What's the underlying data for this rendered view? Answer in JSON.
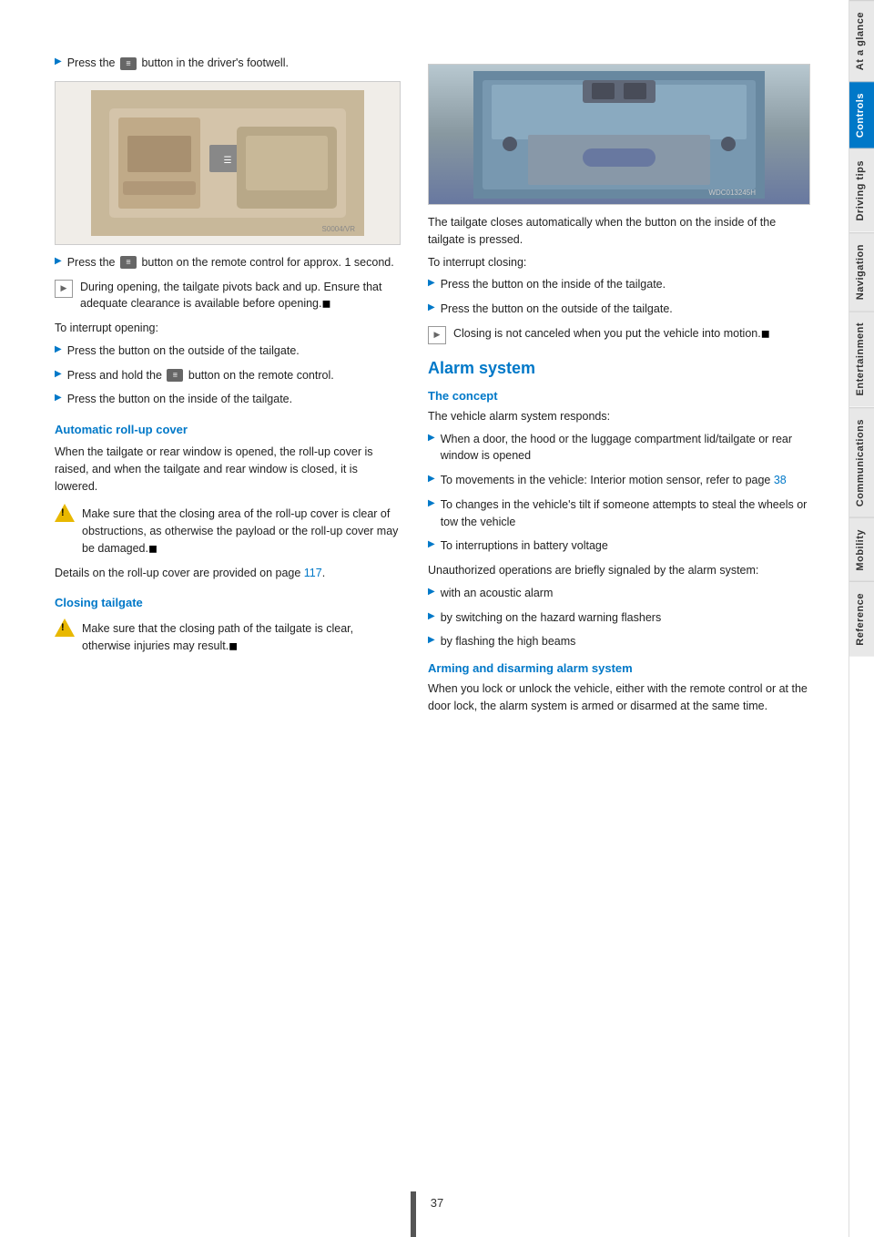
{
  "page": {
    "number": "37"
  },
  "sidebar": {
    "tabs": [
      {
        "id": "at-a-glance",
        "label": "At a glance",
        "active": false
      },
      {
        "id": "controls",
        "label": "Controls",
        "active": true
      },
      {
        "id": "driving-tips",
        "label": "Driving tips",
        "active": false
      },
      {
        "id": "navigation",
        "label": "Navigation",
        "active": false
      },
      {
        "id": "entertainment",
        "label": "Entertainment",
        "active": false
      },
      {
        "id": "communications",
        "label": "Communications",
        "active": false
      },
      {
        "id": "mobility",
        "label": "Mobility",
        "active": false
      },
      {
        "id": "reference",
        "label": "Reference",
        "active": false
      }
    ]
  },
  "left_column": {
    "intro_bullet": "Press the [icon] button in the driver's footwell.",
    "bullet2": "Press the [icon] button on the remote control for approx. 1 second.",
    "notice1": "During opening, the tailgate pivots back and up. Ensure that adequate clearance is available before opening.",
    "to_interrupt_opening": "To interrupt opening:",
    "interrupt_bullets": [
      "Press the button on the outside of the tailgate.",
      "Press and hold the [icon] button on the remote control.",
      "Press the button on the inside of the tailgate."
    ],
    "automatic_rollup_heading": "Automatic roll-up cover",
    "automatic_rollup_text": "When the tailgate or rear window is opened, the roll-up cover is raised, and when the tailgate and rear window is closed, it is lowered.",
    "warning1": "Make sure that the closing area of the roll-up cover is clear of obstructions, as otherwise the payload or the roll-up cover may be damaged.",
    "details_text": "Details on the roll-up cover are provided on page 117.",
    "closing_tailgate_heading": "Closing tailgate",
    "warning2": "Make sure that the closing path of the tailgate is clear, otherwise injuries may result."
  },
  "right_column": {
    "image_caption_text": "The tailgate closes automatically when the button on the inside of the tailgate is pressed.",
    "to_interrupt_closing": "To interrupt closing:",
    "interrupt_closing_bullets": [
      "Press the button on the inside of the tailgate.",
      "Press the button on the outside of the tailgate."
    ],
    "notice_closing": "Closing is not canceled when you put the vehicle into motion.",
    "alarm_system_heading": "Alarm system",
    "the_concept_heading": "The concept",
    "concept_intro": "The vehicle alarm system responds:",
    "concept_bullets": [
      "When a door, the hood or the luggage compartment lid/tailgate or rear window is opened",
      "To movements in the vehicle: Interior motion sensor, refer to page 38",
      "To changes in the vehicle's tilt if someone attempts to steal the wheels or tow the vehicle",
      "To interruptions in battery voltage"
    ],
    "unauthorized_text": "Unauthorized operations are briefly signaled by the alarm system:",
    "unauthorized_bullets": [
      "with an acoustic alarm",
      "by switching on the hazard warning flashers",
      "by flashing the high beams"
    ],
    "arming_heading": "Arming and disarming alarm system",
    "arming_text": "When you lock or unlock the vehicle, either with the remote control or at the door lock, the alarm system is armed or disarmed at the same time."
  }
}
